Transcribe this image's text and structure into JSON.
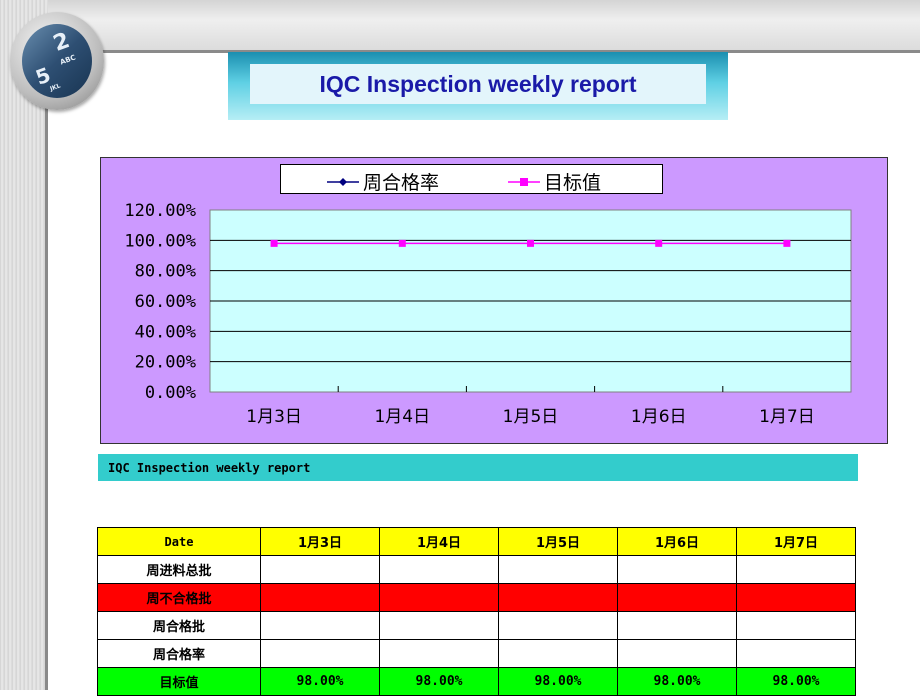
{
  "header": {
    "title": "IQC Inspection weekly report"
  },
  "badge": {
    "key_top": "2",
    "key_top_sub": "ABC",
    "key_bottom": "5",
    "key_bottom_sub": "JKL"
  },
  "legend": [
    {
      "name": "周合格率",
      "color": "#000080",
      "marker": "diamond"
    },
    {
      "name": "目标值",
      "color": "#ff00ff",
      "marker": "square"
    }
  ],
  "chart_data": {
    "type": "line",
    "categories": [
      "1月3日",
      "1月4日",
      "1月5日",
      "1月6日",
      "1月7日"
    ],
    "series": [
      {
        "name": "周合格率",
        "values": [
          null,
          null,
          null,
          null,
          null
        ],
        "color": "#000080"
      },
      {
        "name": "目标值",
        "values": [
          0.98,
          0.98,
          0.98,
          0.98,
          0.98
        ],
        "color": "#ff00ff"
      }
    ],
    "ylim": [
      0,
      1.2
    ],
    "yticks": [
      "0.00%",
      "20.00%",
      "40.00%",
      "60.00%",
      "80.00%",
      "100.00%",
      "120.00%"
    ],
    "grid": true,
    "legend_position": "top",
    "plot_bg": "#ccffff",
    "chart_bg": "#cc99ff"
  },
  "section_title": "IQC Inspection weekly report",
  "table": {
    "header": [
      "Date",
      "1月3日",
      "1月4日",
      "1月5日",
      "1月6日",
      "1月7日"
    ],
    "rows": [
      {
        "label": "周进料总批",
        "values": [
          "",
          "",
          "",
          "",
          ""
        ],
        "style": "white"
      },
      {
        "label": "周不合格批",
        "values": [
          "",
          "",
          "",
          "",
          ""
        ],
        "style": "red"
      },
      {
        "label": "周合格批",
        "values": [
          "",
          "",
          "",
          "",
          ""
        ],
        "style": "white"
      },
      {
        "label": "周合格率",
        "values": [
          "",
          "",
          "",
          "",
          ""
        ],
        "style": "white"
      },
      {
        "label": "目标值",
        "values": [
          "98.00%",
          "98.00%",
          "98.00%",
          "98.00%",
          "98.00%"
        ],
        "style": "green"
      }
    ]
  }
}
